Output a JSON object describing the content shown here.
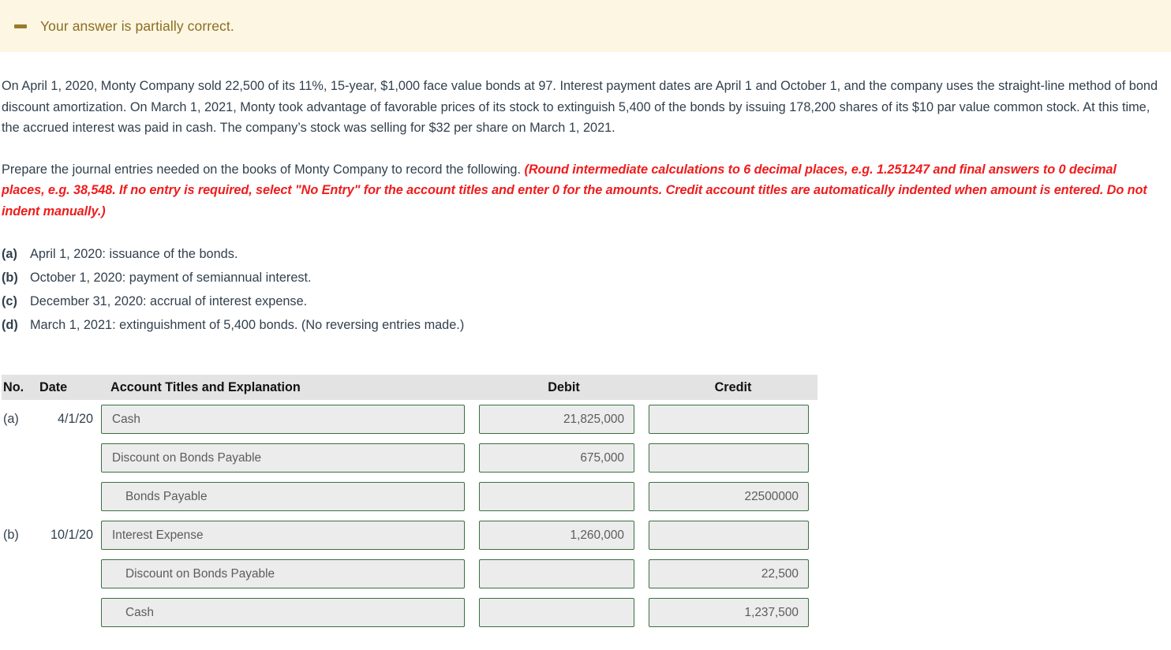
{
  "banner": {
    "icon": "dash-icon",
    "message": "Your answer is partially correct.",
    "background_color": "#fdf6e3",
    "text_color": "#8a6d1f"
  },
  "problem": {
    "paragraph": "On April 1, 2020, Monty Company sold 22,500 of its 11%, 15-year, $1,000 face value bonds at 97. Interest payment dates are April 1 and October 1, and the company uses the straight-line method of bond discount amortization. On March 1, 2021, Monty took advantage of favorable prices of its stock to extinguish 5,400 of the bonds by issuing 178,200 shares of its $10 par value common stock. At this time, the accrued interest was paid in cash. The company’s stock was selling for $32 per share on March 1, 2021."
  },
  "instruction": {
    "lead": "Prepare the journal entries needed on the books of Monty Company to record the following.",
    "hint": "(Round intermediate calculations to 6 decimal places, e.g. 1.251247 and final answers to 0 decimal places, e.g. 38,548. If no entry is required, select \"No Entry\" for the account titles and enter 0 for the amounts. Credit account titles are automatically indented when amount is entered. Do not indent manually.)",
    "hint_color": "#ef1c1c"
  },
  "requirements": [
    {
      "key": "(a)",
      "text": "April 1, 2020: issuance of the bonds."
    },
    {
      "key": "(b)",
      "text": "October 1, 2020: payment of semiannual interest."
    },
    {
      "key": "(c)",
      "text": "December 31, 2020: accrual of interest expense."
    },
    {
      "key": "(d)",
      "text": "March 1, 2021: extinguishment of 5,400 bonds. (No reversing entries made.)"
    }
  ],
  "journal": {
    "headers": {
      "no": "No.",
      "date": "Date",
      "account": "Account Titles and Explanation",
      "debit": "Debit",
      "credit": "Credit"
    },
    "header_background": "#e3e3e3",
    "field_border_color": "#3a7040",
    "field_background": "#ececec",
    "rows": [
      {
        "no": "(a)",
        "date": "4/1/20",
        "account": "Cash",
        "indent": false,
        "debit": "21,825,000",
        "credit": ""
      },
      {
        "no": "",
        "date": "",
        "account": "Discount on Bonds Payable",
        "indent": false,
        "debit": "675,000",
        "credit": ""
      },
      {
        "no": "",
        "date": "",
        "account": "Bonds Payable",
        "indent": true,
        "debit": "",
        "credit": "22500000"
      },
      {
        "no": "(b)",
        "date": "10/1/20",
        "account": "Interest Expense",
        "indent": false,
        "debit": "1,260,000",
        "credit": ""
      },
      {
        "no": "",
        "date": "",
        "account": "Discount on Bonds Payable",
        "indent": true,
        "debit": "",
        "credit": "22,500"
      },
      {
        "no": "",
        "date": "",
        "account": "Cash",
        "indent": true,
        "debit": "",
        "credit": "1,237,500"
      }
    ]
  }
}
